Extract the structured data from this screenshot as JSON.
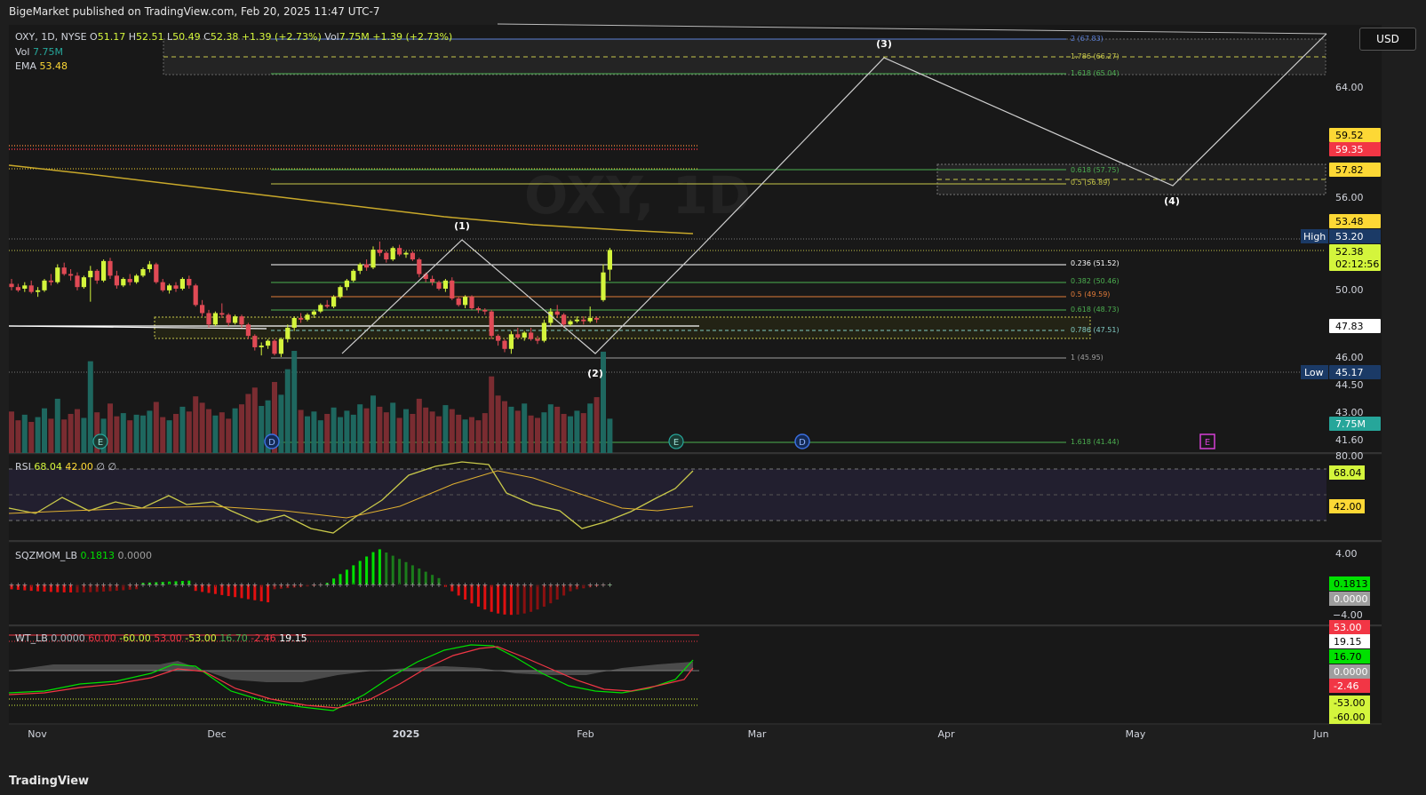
{
  "header": {
    "publisher_line": "BigeMarket published on TradingView.com, Feb 20, 2025 11:47 UTC-7"
  },
  "footer": {
    "logo_text": "TradingView"
  },
  "currency_button": "USD",
  "legend": {
    "symbol": "OXY, 1D, NYSE",
    "o_label": "O",
    "o": "51.17",
    "h_label": "H",
    "h": "52.51",
    "l_label": "L",
    "l": "50.49",
    "c_label": "C",
    "c": "52.38",
    "change": "+1.39 (+2.73%)",
    "vol_label_inline": "Vol",
    "vol_inline": "7.75M",
    "change2": "+1.39 (+2.73%)",
    "vol_label": "Vol",
    "vol": "7.75M",
    "ema_label": "EMA",
    "ema": "53.48"
  },
  "price_axis": {
    "ticks": [
      "64.00",
      "56.00",
      "50.00",
      "46.00",
      "44.50",
      "43.00",
      "41.60"
    ],
    "badges": [
      {
        "text": "59.52",
        "bg": "#fdd835",
        "fg": "#000"
      },
      {
        "text": "59.35",
        "bg": "#f23645",
        "fg": "#fff"
      },
      {
        "text": "57.82",
        "bg": "#fdd835",
        "fg": "#000"
      },
      {
        "text": "53.48",
        "bg": "#fdd835",
        "fg": "#000"
      },
      {
        "text": "53.20",
        "bg": "#1b3a66",
        "fg": "#fff"
      },
      {
        "text": "52.38",
        "bg": "#d4f53c",
        "fg": "#000"
      },
      {
        "text": "02:12:56",
        "bg": "#d4f53c",
        "fg": "#000"
      },
      {
        "text": "47.83",
        "bg": "#ffffff",
        "fg": "#000"
      },
      {
        "text": "45.17",
        "bg": "#1b3a66",
        "fg": "#fff"
      },
      {
        "text": "7.75M",
        "bg": "#26a69a",
        "fg": "#fff"
      }
    ],
    "high_label": "High",
    "low_label": "Low"
  },
  "time_axis": [
    "Nov",
    "Dec",
    "2025",
    "Feb",
    "Mar",
    "Apr",
    "May",
    "Jun"
  ],
  "fib_labels": [
    "2 (67.83)",
    "1.786 (66.27)",
    "1.618 (65.04)",
    "0.618 (57.75)",
    "0.5 (56.89)",
    "0.236 (51.52)",
    "0.382 (50.46)",
    "0.5 (49.59)",
    "0.618 (48.73)",
    "0.786 (47.51)",
    "1 (45.95)",
    "1.618 (41.44)"
  ],
  "wave_labels": [
    "(1)",
    "(2)",
    "(3)",
    "(4)"
  ],
  "event_markers": [
    {
      "text": "E",
      "kind": "earnings"
    },
    {
      "text": "D",
      "kind": "dividend"
    },
    {
      "text": "E",
      "kind": "earnings"
    },
    {
      "text": "D",
      "kind": "dividend"
    },
    {
      "text": "E",
      "kind": "earnings-future"
    }
  ],
  "rsi": {
    "name": "RSI",
    "v1": "68.04",
    "v2": "42.00",
    "v3": "∅",
    "v4": "∅",
    "axis_top": "80.00",
    "badge1": "68.04",
    "badge2": "42.00"
  },
  "sqz": {
    "name": "SQZMOM_LB",
    "v1": "0.1813",
    "v2": "0.0000",
    "axis_top": "4.00",
    "axis_bottom": "−4.00",
    "badge1": "0.1813",
    "badge2": "0.0000"
  },
  "wt": {
    "name": "WT_LB",
    "vals": [
      {
        "t": "0.0000",
        "c": "#b2b5be"
      },
      {
        "t": "60.00",
        "c": "#f23645"
      },
      {
        "t": "-60.00",
        "c": "#d4f53c"
      },
      {
        "t": "53.00",
        "c": "#f23645"
      },
      {
        "t": "-53.00",
        "c": "#d4f53c"
      },
      {
        "t": "16.70",
        "c": "#4caf50"
      },
      {
        "t": "-2.46",
        "c": "#f23645"
      },
      {
        "t": "19.15",
        "c": "#ffffff"
      }
    ],
    "badges": [
      {
        "text": "53.00",
        "bg": "#f23645",
        "fg": "#fff"
      },
      {
        "text": "19.15",
        "bg": "#ffffff",
        "fg": "#000"
      },
      {
        "text": "16.70",
        "bg": "#00e000",
        "fg": "#000"
      },
      {
        "text": "0.0000",
        "bg": "#9e9e9e",
        "fg": "#fff"
      },
      {
        "text": "-2.46",
        "bg": "#f23645",
        "fg": "#fff"
      },
      {
        "text": "-53.00",
        "bg": "#d4f53c",
        "fg": "#000"
      },
      {
        "text": "-60.00",
        "bg": "#d4f53c",
        "fg": "#000"
      }
    ]
  },
  "chart_data": {
    "type": "candlestick",
    "symbol": "OXY",
    "interval": "1D",
    "y_range": [
      40.6,
      68.5
    ],
    "last_close": 52.38,
    "ema_last": 53.48,
    "candles_ohlc": [
      [
        50.3,
        50.6,
        49.9,
        50.1
      ],
      [
        50.1,
        50.3,
        49.8,
        49.9
      ],
      [
        50.0,
        50.4,
        49.8,
        50.2
      ],
      [
        50.2,
        50.5,
        49.7,
        49.8
      ],
      [
        49.8,
        50.1,
        49.5,
        49.9
      ],
      [
        49.9,
        50.6,
        49.8,
        50.5
      ],
      [
        50.5,
        50.9,
        50.2,
        50.4
      ],
      [
        50.4,
        51.5,
        50.3,
        51.3
      ],
      [
        51.3,
        51.6,
        50.8,
        50.9
      ],
      [
        50.9,
        51.2,
        50.5,
        50.8
      ],
      [
        50.8,
        51.0,
        49.9,
        50.1
      ],
      [
        50.1,
        50.8,
        50.0,
        50.7
      ],
      [
        50.7,
        51.4,
        49.2,
        51.1
      ],
      [
        51.1,
        51.2,
        50.3,
        50.5
      ],
      [
        50.5,
        51.8,
        50.4,
        51.7
      ],
      [
        51.7,
        51.9,
        50.6,
        50.8
      ],
      [
        50.8,
        51.1,
        50.0,
        50.2
      ],
      [
        50.2,
        50.7,
        50.1,
        50.6
      ],
      [
        50.6,
        50.9,
        50.2,
        50.4
      ],
      [
        50.4,
        50.9,
        50.3,
        50.8
      ],
      [
        50.8,
        51.3,
        50.7,
        51.2
      ],
      [
        51.2,
        51.7,
        51.0,
        51.5
      ],
      [
        51.5,
        51.6,
        50.3,
        50.4
      ],
      [
        50.4,
        50.6,
        49.8,
        49.9
      ],
      [
        49.9,
        50.3,
        49.7,
        50.2
      ],
      [
        50.2,
        50.4,
        49.8,
        50.0
      ],
      [
        50.0,
        50.7,
        49.9,
        50.6
      ],
      [
        50.6,
        50.8,
        50.0,
        50.2
      ],
      [
        50.2,
        50.3,
        48.9,
        49.0
      ],
      [
        49.0,
        49.3,
        48.3,
        48.5
      ],
      [
        48.5,
        48.7,
        47.6,
        47.8
      ],
      [
        47.8,
        48.6,
        47.7,
        48.5
      ],
      [
        48.5,
        49.1,
        48.2,
        48.4
      ],
      [
        48.4,
        48.5,
        47.7,
        47.9
      ],
      [
        47.9,
        48.4,
        47.8,
        48.3
      ],
      [
        48.3,
        48.4,
        47.6,
        47.8
      ],
      [
        47.8,
        47.9,
        46.9,
        47.1
      ],
      [
        47.1,
        47.2,
        46.2,
        46.4
      ],
      [
        46.4,
        46.7,
        45.9,
        46.5
      ],
      [
        46.5,
        46.9,
        46.3,
        46.8
      ],
      [
        46.8,
        46.9,
        45.9,
        46.0
      ],
      [
        46.0,
        47.0,
        45.8,
        46.9
      ],
      [
        46.9,
        47.8,
        46.7,
        47.6
      ],
      [
        47.6,
        48.3,
        47.4,
        48.2
      ],
      [
        48.2,
        48.5,
        47.9,
        48.1
      ],
      [
        48.1,
        48.5,
        48.0,
        48.4
      ],
      [
        48.4,
        48.7,
        48.2,
        48.6
      ],
      [
        48.6,
        49.1,
        48.5,
        49.0
      ],
      [
        49.0,
        49.3,
        48.8,
        48.9
      ],
      [
        48.9,
        49.6,
        48.8,
        49.5
      ],
      [
        49.5,
        50.2,
        49.4,
        50.1
      ],
      [
        50.1,
        50.6,
        49.9,
        50.5
      ],
      [
        50.5,
        51.2,
        50.4,
        51.1
      ],
      [
        51.1,
        51.6,
        50.9,
        51.5
      ],
      [
        51.5,
        51.8,
        51.1,
        51.3
      ],
      [
        51.3,
        52.6,
        51.2,
        52.4
      ],
      [
        52.4,
        52.9,
        52.0,
        52.2
      ],
      [
        52.2,
        52.3,
        51.6,
        51.8
      ],
      [
        51.8,
        52.6,
        51.7,
        52.5
      ],
      [
        52.5,
        52.7,
        52.0,
        52.1
      ],
      [
        52.1,
        52.3,
        51.9,
        52.2
      ],
      [
        52.2,
        52.3,
        51.7,
        51.8
      ],
      [
        51.8,
        51.9,
        50.7,
        50.9
      ],
      [
        50.9,
        51.0,
        50.4,
        50.6
      ],
      [
        50.6,
        50.8,
        50.2,
        50.4
      ],
      [
        50.4,
        50.5,
        49.9,
        50.0
      ],
      [
        50.0,
        50.6,
        49.8,
        50.5
      ],
      [
        50.5,
        50.7,
        49.3,
        49.4
      ],
      [
        49.4,
        49.5,
        48.9,
        49.0
      ],
      [
        49.0,
        49.6,
        48.8,
        49.5
      ],
      [
        49.5,
        49.6,
        48.7,
        48.8
      ],
      [
        48.8,
        48.9,
        48.5,
        48.7
      ],
      [
        48.7,
        48.8,
        48.4,
        48.6
      ],
      [
        48.6,
        48.7,
        46.9,
        47.1
      ],
      [
        47.1,
        47.2,
        46.5,
        46.8
      ],
      [
        46.8,
        46.9,
        46.1,
        46.3
      ],
      [
        46.3,
        47.4,
        46.0,
        47.2
      ],
      [
        47.2,
        47.6,
        46.9,
        47.0
      ],
      [
        47.0,
        47.4,
        46.8,
        47.3
      ],
      [
        47.3,
        47.6,
        46.8,
        46.9
      ],
      [
        46.9,
        47.1,
        46.6,
        46.8
      ],
      [
        46.8,
        48.1,
        46.7,
        47.9
      ],
      [
        47.9,
        48.8,
        47.7,
        48.6
      ],
      [
        48.6,
        49.0,
        48.2,
        48.4
      ],
      [
        48.4,
        48.5,
        47.6,
        47.8
      ],
      [
        47.8,
        48.1,
        47.7,
        48.0
      ],
      [
        48.0,
        48.3,
        47.9,
        48.1
      ],
      [
        48.1,
        48.3,
        47.8,
        48.0
      ],
      [
        48.0,
        48.9,
        47.9,
        48.2
      ],
      [
        48.2,
        48.3,
        47.9,
        48.1
      ],
      [
        49.3,
        51.5,
        49.2,
        51.0
      ],
      [
        51.17,
        52.51,
        50.49,
        52.38
      ]
    ],
    "volume_millions": [
      5.2,
      4.1,
      4.8,
      3.9,
      4.5,
      5.6,
      4.3,
      6.8,
      4.2,
      4.9,
      5.5,
      4.4,
      11.5,
      5.1,
      4.3,
      6.2,
      4.6,
      5.0,
      4.1,
      4.8,
      4.7,
      5.3,
      6.4,
      4.5,
      4.1,
      4.9,
      5.8,
      5.2,
      7.1,
      6.3,
      5.5,
      4.7,
      5.1,
      4.3,
      5.6,
      6.1,
      7.4,
      8.2,
      5.9,
      6.6,
      8.9,
      7.3,
      10.5,
      12.8,
      5.4,
      4.6,
      5.2,
      4.1,
      4.9,
      5.7,
      4.5,
      5.3,
      4.8,
      6.1,
      5.6,
      7.2,
      5.8,
      5.1,
      6.3,
      4.4,
      5.5,
      4.9,
      6.8,
      5.7,
      5.2,
      4.6,
      6.0,
      5.5,
      4.8,
      4.2,
      4.5,
      4.1,
      5.0,
      9.6,
      7.2,
      6.5,
      5.8,
      5.3,
      6.2,
      4.7,
      4.4,
      5.1,
      6.1,
      5.8,
      4.9,
      4.6,
      5.3,
      5.0,
      6.2,
      7.0,
      12.7,
      4.3
    ]
  }
}
